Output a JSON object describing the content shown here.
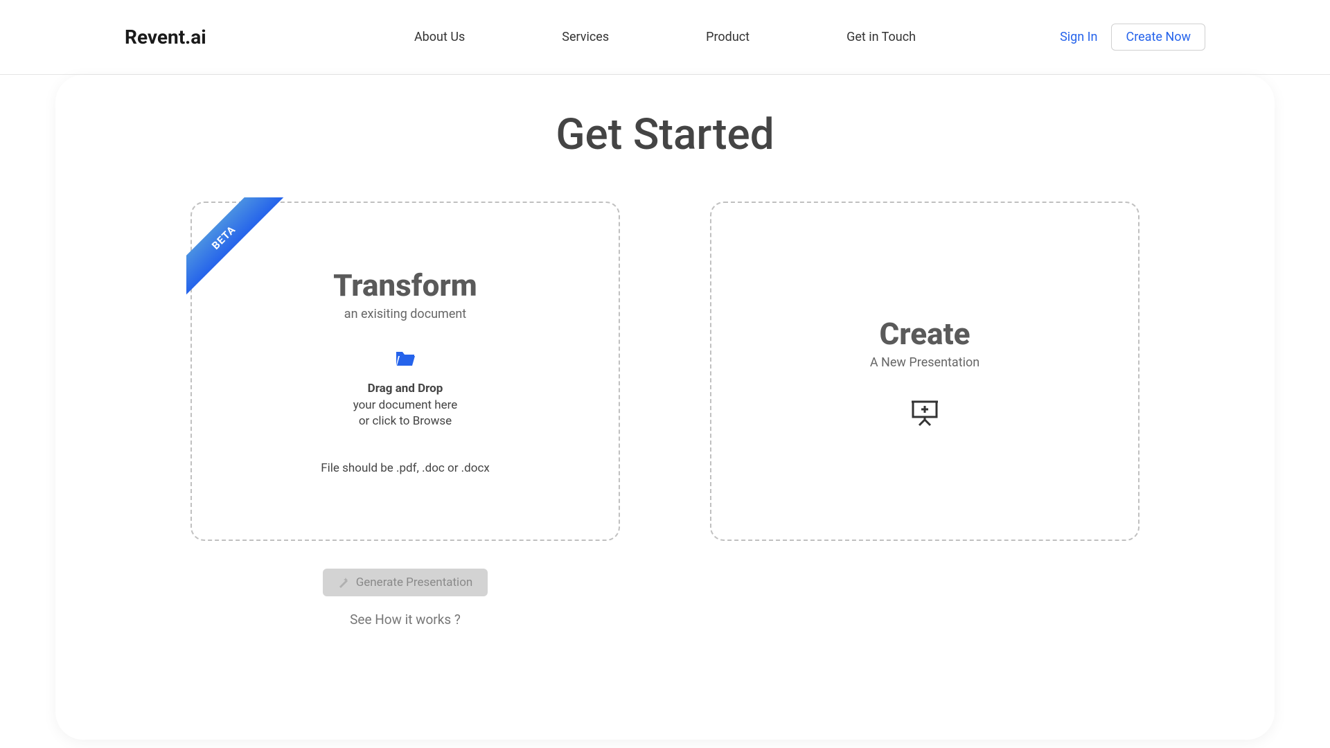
{
  "header": {
    "logo": "Revent.ai",
    "nav": {
      "about": "About Us",
      "services": "Services",
      "product": "Product",
      "contact": "Get in Touch"
    },
    "sign_in": "Sign In",
    "create_now": "Create Now"
  },
  "page": {
    "title": "Get Started"
  },
  "transform_card": {
    "ribbon": "BETA",
    "title": "Transform",
    "subtitle": "an exisiting document",
    "drop_bold": "Drag and Drop",
    "drop_line1": "your document here",
    "drop_line2": "or click to Browse",
    "file_hint": "File should be .pdf, .doc or .docx"
  },
  "create_card": {
    "title": "Create",
    "subtitle": "A New Presentation"
  },
  "actions": {
    "generate": "Generate Presentation",
    "how_works": "See How it works ?"
  },
  "colors": {
    "primary_blue": "#2563eb"
  }
}
